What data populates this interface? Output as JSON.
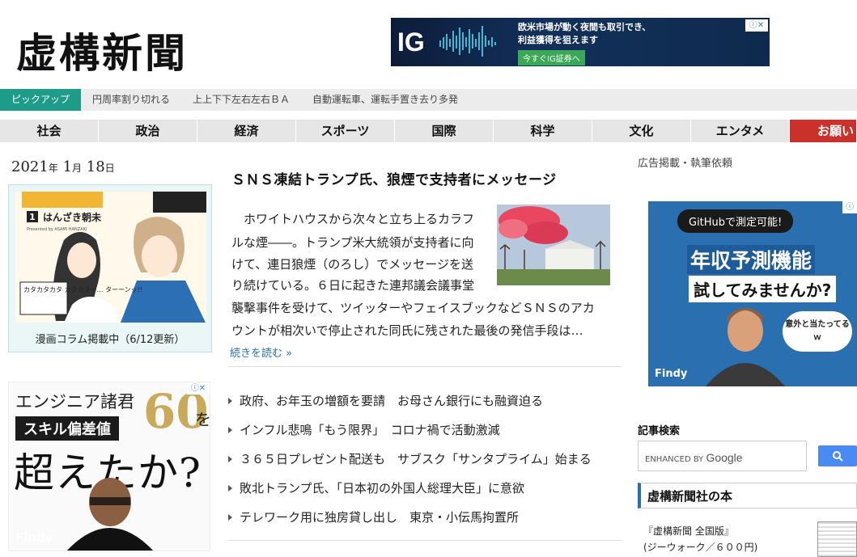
{
  "header": {
    "logo": "虚構新聞",
    "ad": {
      "brand": "IG",
      "line1": "欧米市場が動く夜間も取引でき、",
      "line2": "利益獲得を狙えます",
      "cta": "今すぐIG証券へ",
      "adchoice": "ⓘ✕"
    }
  },
  "pickup": {
    "label": "ピックアップ",
    "items": [
      "円周率割り切れる",
      "上上下下左右左右ＢＡ",
      "自動運転車、運転手置き去り多発"
    ]
  },
  "nav": {
    "tabs": [
      "社会",
      "政治",
      "経済",
      "スポーツ",
      "国際",
      "科学",
      "文化",
      "エンタメ",
      "お願い"
    ]
  },
  "left": {
    "date_year": "2021",
    "date_y": "年",
    "date_month": "1",
    "date_m": "月",
    "date_day": "18",
    "date_d": "日",
    "manga_caption": "漫画コラム掲載中（6/12更新）",
    "manga_title_number": "1",
    "manga_author": "はんざき朝未",
    "manga_author_en": "Presented by ASAMI HANZAKI",
    "manga_speech": "カタカタカタ カタカター… ターーンッ!!",
    "ad": {
      "line1": "エンジニア諸君",
      "line2": "スキル偏差値",
      "number": "60",
      "wo": "を",
      "line3": "超えたか?",
      "brand": "Findy",
      "adchoice": "ⓘ✕"
    }
  },
  "article": {
    "headline": "ＳＮＳ凍結トランプ氏、狼煙で支持者にメッセージ",
    "lines": [
      "　ホワイトハウスから次々と立ち上るカラフ",
      "ルな煙――。トランプ米大統領が支持者に向",
      "けて、連日狼煙（のろし）でメッセージを送",
      "り続けている。６日に起きた連邦議会議事堂",
      "襲撃事件を受けて、ツイッターやフェイスブックなどＳＮＳのアカ",
      "ウントが相次いで停止された同氏に残された最後の発信手段は…"
    ],
    "readmore": "続きを読む »"
  },
  "news": [
    "政府、お年玉の増額を要請　お母さん銀行にも融資迫る",
    "インフル悲鳴「もう限界」　コロナ禍で活動激減",
    "３６５日プレゼント配送も　サブスク「サンタプライム」始まる",
    "敗北トランプ氏、「日本初の外国人総理大臣」に意欲",
    "テレワーク用に独房貸し出し　東京・小伝馬拘置所"
  ],
  "right": {
    "ad_link": "広告掲載・執筆依頼",
    "ad": {
      "bubble": "GitHubで測定可能!",
      "line1": "年収予測機能",
      "line2": "試してみませんか?",
      "side": "意外と当たってるｗ",
      "brand": "Findy",
      "adchoice": "ⓘ"
    },
    "search_title": "記事検索",
    "search_enhanced": "ENHANCED BY",
    "search_google": "Google",
    "book_section": "虚構新聞社の本",
    "book_name": "『虚構新聞 全国版』",
    "book_price": "(ジーウォーク／６００円)"
  },
  "colors": {
    "accent": "#1f9b8a",
    "nav_red": "#c8322a",
    "link": "#2a6fa8"
  }
}
